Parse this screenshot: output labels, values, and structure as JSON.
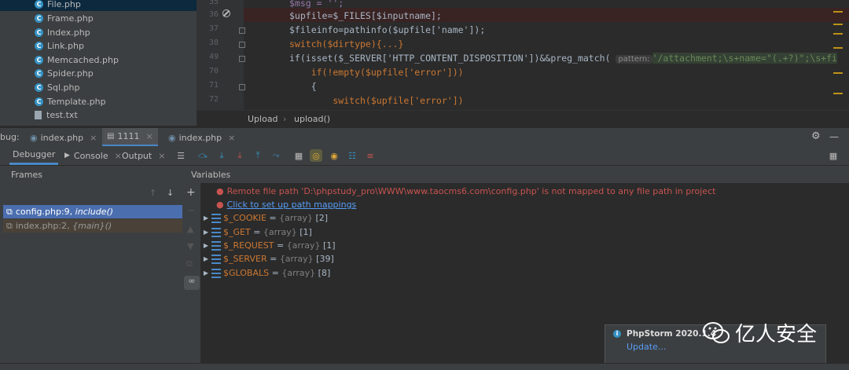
{
  "project_tree": {
    "items": [
      {
        "name": "File.php",
        "icon": "php-class-icon",
        "selected": true
      },
      {
        "name": "Frame.php",
        "icon": "php-class-icon"
      },
      {
        "name": "Index.php",
        "icon": "php-class-icon"
      },
      {
        "name": "Link.php",
        "icon": "php-class-icon"
      },
      {
        "name": "Memcached.php",
        "icon": "php-class-icon"
      },
      {
        "name": "Spider.php",
        "icon": "php-class-icon"
      },
      {
        "name": "Sql.php",
        "icon": "php-class-icon"
      },
      {
        "name": "Template.php",
        "icon": "php-class-icon"
      },
      {
        "name": "test.txt",
        "icon": "text-file-icon"
      }
    ]
  },
  "editor": {
    "lines": [
      {
        "num": "35",
        "code": "$msg = '';"
      },
      {
        "num": "36",
        "code": "$upfile=$_FILES[$inputname];",
        "breakpoint": true
      },
      {
        "num": "37",
        "code": "$fileinfo=pathinfo($upfile['name']);"
      },
      {
        "num": "38",
        "code": "switch($dirtype){...}"
      },
      {
        "num": "49",
        "code": "if(isset($_SERVER['HTTP_CONTENT_DISPOSITION'])&&preg_match(",
        "hint": "pattern:",
        "tail": "'/attachment;\\s+name=\"(.+?)\";\\s+fi"
      },
      {
        "num": "70",
        "code": "    if(!empty($upfile['error']))"
      },
      {
        "num": "71",
        "code": "    {"
      },
      {
        "num": "72",
        "code": "        switch($upfile['error'])"
      }
    ],
    "breadcrumb": [
      "Upload",
      "upload()"
    ]
  },
  "debug": {
    "label": "bug:",
    "sessions": [
      {
        "label": "index.php",
        "active": false
      },
      {
        "label": "1111",
        "active": true
      },
      {
        "label": "index.php",
        "active": false
      }
    ],
    "tabs": [
      "Debugger",
      "Console",
      "Output"
    ],
    "frames_title": "Frames",
    "variables_title": "Variables",
    "frames": [
      {
        "file": "config.php:9,",
        "ctx": "include()",
        "selected": true
      },
      {
        "file": "index.php:2,",
        "ctx": "{main}()",
        "selected": false
      }
    ],
    "error_message": "Remote file path 'D:\\phpstudy_pro\\WWW\\www.taocms6.com\\config.php' is not mapped to any file path in project",
    "link_text": "Click to set up path mappings",
    "variables": [
      {
        "name": "$_COOKIE",
        "type": "{array}",
        "count": "[2]"
      },
      {
        "name": "$_GET",
        "type": "{array}",
        "count": "[1]"
      },
      {
        "name": "$_REQUEST",
        "type": "{array}",
        "count": "[1]"
      },
      {
        "name": "$_SERVER",
        "type": "{array}",
        "count": "[39]"
      },
      {
        "name": "$GLOBALS",
        "type": "{array}",
        "count": "[8]"
      }
    ]
  },
  "notification": {
    "title": "PhpStorm 2020.1.4",
    "action": "Update..."
  },
  "watermark": "亿人安全"
}
